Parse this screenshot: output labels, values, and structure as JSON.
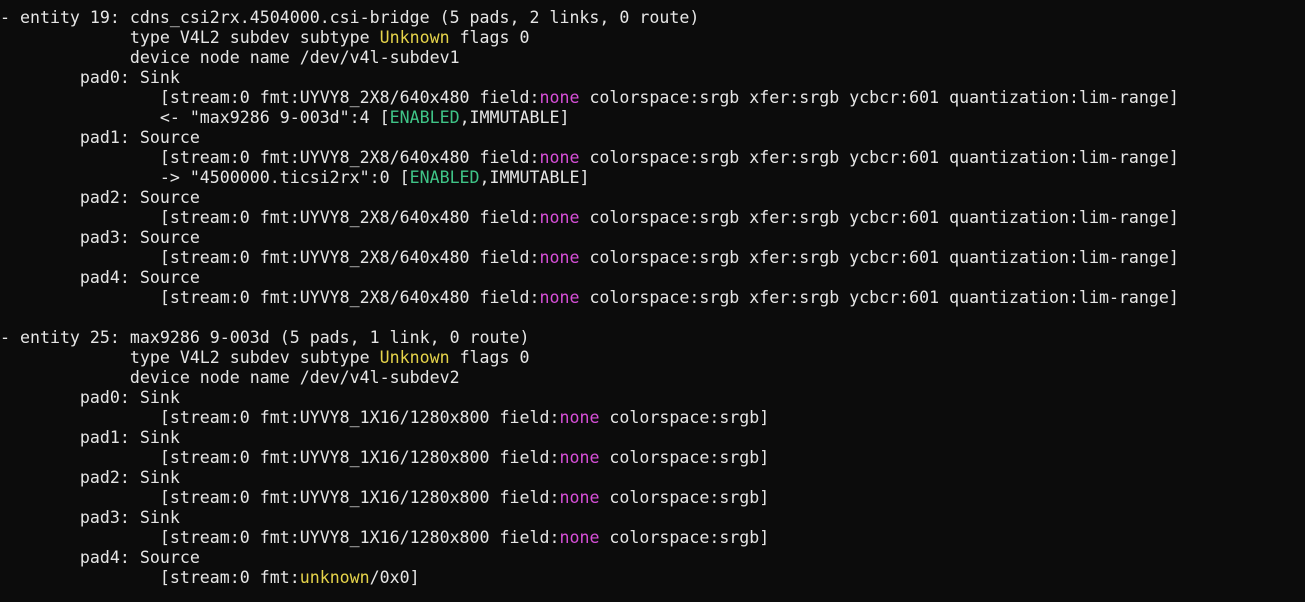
{
  "colors": {
    "background": "#0c0c0c",
    "default_text": "#e6e6e6",
    "magenta": "#d74fd8",
    "yellow": "#e5d34a",
    "green": "#3fc487"
  },
  "terminal": {
    "lines": [
      [
        {
          "t": "- entity 19: cdns_csi2rx.4504000.csi-bridge (5 pads, 2 links, 0 route)",
          "c": "default"
        }
      ],
      [
        {
          "t": "             type V4L2 subdev subtype ",
          "c": "default"
        },
        {
          "t": "Unknown",
          "c": "yellow"
        },
        {
          "t": " flags 0",
          "c": "default"
        }
      ],
      [
        {
          "t": "             device node name /dev/v4l-subdev1",
          "c": "default"
        }
      ],
      [
        {
          "t": "        pad0: Sink",
          "c": "default"
        }
      ],
      [
        {
          "t": "                [stream:0 fmt:UYVY8_2X8/640x480 field:",
          "c": "default"
        },
        {
          "t": "none",
          "c": "magenta"
        },
        {
          "t": " colorspace:srgb xfer:srgb ycbcr:601 quantization:lim-range]",
          "c": "default"
        }
      ],
      [
        {
          "t": "                <- \"max9286 9-003d\":4 [",
          "c": "default"
        },
        {
          "t": "ENABLED",
          "c": "green"
        },
        {
          "t": ",IMMUTABLE]",
          "c": "default"
        }
      ],
      [
        {
          "t": "        pad1: Source",
          "c": "default"
        }
      ],
      [
        {
          "t": "                [stream:0 fmt:UYVY8_2X8/640x480 field:",
          "c": "default"
        },
        {
          "t": "none",
          "c": "magenta"
        },
        {
          "t": " colorspace:srgb xfer:srgb ycbcr:601 quantization:lim-range]",
          "c": "default"
        }
      ],
      [
        {
          "t": "                -> \"4500000.ticsi2rx\":0 [",
          "c": "default"
        },
        {
          "t": "ENABLED",
          "c": "green"
        },
        {
          "t": ",IMMUTABLE]",
          "c": "default"
        }
      ],
      [
        {
          "t": "        pad2: Source",
          "c": "default"
        }
      ],
      [
        {
          "t": "                [stream:0 fmt:UYVY8_2X8/640x480 field:",
          "c": "default"
        },
        {
          "t": "none",
          "c": "magenta"
        },
        {
          "t": " colorspace:srgb xfer:srgb ycbcr:601 quantization:lim-range]",
          "c": "default"
        }
      ],
      [
        {
          "t": "        pad3: Source",
          "c": "default"
        }
      ],
      [
        {
          "t": "                [stream:0 fmt:UYVY8_2X8/640x480 field:",
          "c": "default"
        },
        {
          "t": "none",
          "c": "magenta"
        },
        {
          "t": " colorspace:srgb xfer:srgb ycbcr:601 quantization:lim-range]",
          "c": "default"
        }
      ],
      [
        {
          "t": "        pad4: Source",
          "c": "default"
        }
      ],
      [
        {
          "t": "                [stream:0 fmt:UYVY8_2X8/640x480 field:",
          "c": "default"
        },
        {
          "t": "none",
          "c": "magenta"
        },
        {
          "t": " colorspace:srgb xfer:srgb ycbcr:601 quantization:lim-range]",
          "c": "default"
        }
      ],
      [
        {
          "t": "",
          "c": "default"
        }
      ],
      [
        {
          "t": "- entity 25: max9286 9-003d (5 pads, 1 link, 0 route)",
          "c": "default"
        }
      ],
      [
        {
          "t": "             type V4L2 subdev subtype ",
          "c": "default"
        },
        {
          "t": "Unknown",
          "c": "yellow"
        },
        {
          "t": " flags 0",
          "c": "default"
        }
      ],
      [
        {
          "t": "             device node name /dev/v4l-subdev2",
          "c": "default"
        }
      ],
      [
        {
          "t": "        pad0: Sink",
          "c": "default"
        }
      ],
      [
        {
          "t": "                [stream:0 fmt:UYVY8_1X16/1280x800 field:",
          "c": "default"
        },
        {
          "t": "none",
          "c": "magenta"
        },
        {
          "t": " colorspace:srgb]",
          "c": "default"
        }
      ],
      [
        {
          "t": "        pad1: Sink",
          "c": "default"
        }
      ],
      [
        {
          "t": "                [stream:0 fmt:UYVY8_1X16/1280x800 field:",
          "c": "default"
        },
        {
          "t": "none",
          "c": "magenta"
        },
        {
          "t": " colorspace:srgb]",
          "c": "default"
        }
      ],
      [
        {
          "t": "        pad2: Sink",
          "c": "default"
        }
      ],
      [
        {
          "t": "                [stream:0 fmt:UYVY8_1X16/1280x800 field:",
          "c": "default"
        },
        {
          "t": "none",
          "c": "magenta"
        },
        {
          "t": " colorspace:srgb]",
          "c": "default"
        }
      ],
      [
        {
          "t": "        pad3: Sink",
          "c": "default"
        }
      ],
      [
        {
          "t": "                [stream:0 fmt:UYVY8_1X16/1280x800 field:",
          "c": "default"
        },
        {
          "t": "none",
          "c": "magenta"
        },
        {
          "t": " colorspace:srgb]",
          "c": "default"
        }
      ],
      [
        {
          "t": "        pad4: Source",
          "c": "default"
        }
      ],
      [
        {
          "t": "                [stream:0 fmt:",
          "c": "default"
        },
        {
          "t": "unknown",
          "c": "yellow"
        },
        {
          "t": "/0x0]",
          "c": "default"
        }
      ]
    ]
  }
}
